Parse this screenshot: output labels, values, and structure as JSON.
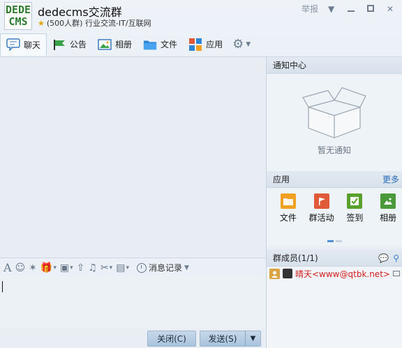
{
  "header": {
    "logo_line1": "DEDE",
    "logo_line2": "CMS",
    "group_name": "dedecms交流群",
    "group_info": "(500人群) 行业交流-IT/互联网",
    "report_label": "举报"
  },
  "tabs": [
    {
      "label": "聊天",
      "icon": "chat-icon"
    },
    {
      "label": "公告",
      "icon": "announcement-icon"
    },
    {
      "label": "相册",
      "icon": "photo-icon"
    },
    {
      "label": "文件",
      "icon": "folder-icon"
    },
    {
      "label": "应用",
      "icon": "apps-icon"
    }
  ],
  "input_toolbar": {
    "history_label": "消息记录"
  },
  "buttons": {
    "close_label": "关闭(C)",
    "send_label": "发送(S)"
  },
  "notice": {
    "title": "通知中心",
    "empty_text": "暂无通知"
  },
  "apps_section": {
    "title": "应用",
    "more_label": "更多",
    "items": [
      {
        "label": "文件",
        "color": "#f0a022"
      },
      {
        "label": "群活动",
        "color": "#e05a3a"
      },
      {
        "label": "签到",
        "color": "#5aa02c"
      },
      {
        "label": "相册",
        "color": "#4a9a3c"
      }
    ]
  },
  "members": {
    "title": "群成员(1/1)",
    "list": [
      {
        "name": "晴天<www@qtbk.net>"
      }
    ]
  },
  "colors": {
    "accent": "#2a6cb8",
    "member_name": "#d01e1e"
  }
}
